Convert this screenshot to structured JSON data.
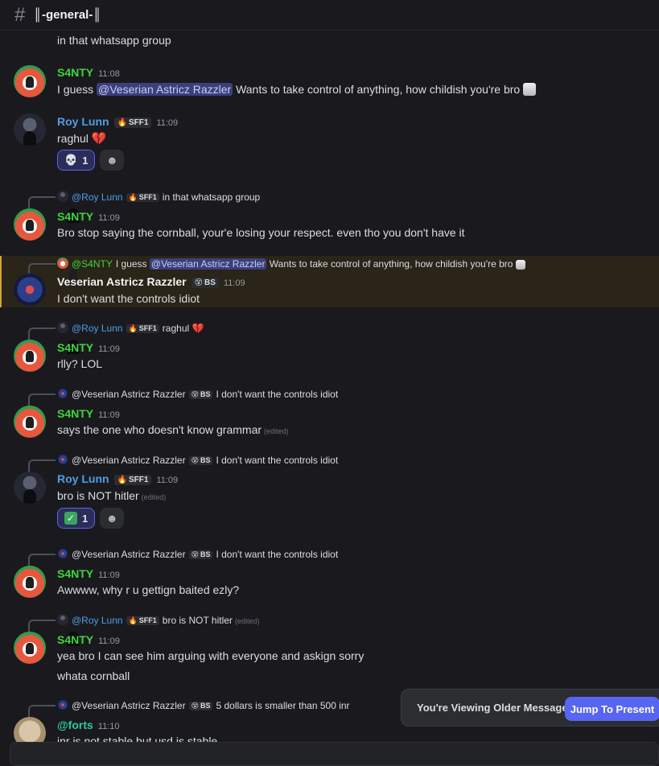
{
  "channel": {
    "name": "║-general-║"
  },
  "top_line": "in that whatsapp group",
  "messages": {
    "m1": {
      "user": "S4NTY",
      "time": "11:08",
      "pre": "I guess ",
      "mention": "@Veserian Astricz Razzler",
      "post": " Wants to take control of anything, how childish you're bro"
    },
    "m2": {
      "user": "Roy Lunn",
      "tag": "SFF1",
      "time": "11:09",
      "text": "raghul",
      "reaction_count": "1"
    },
    "m3": {
      "reply_user": "@Roy Lunn",
      "reply_tag": "SFF1",
      "reply_text": "in that whatsapp group",
      "user": "S4NTY",
      "time": "11:09",
      "text": "Bro stop saying the cornball, your'e losing your respect. even tho you don't have it"
    },
    "m4": {
      "reply_user": "@S4NTY",
      "reply_pre": "I guess ",
      "reply_mention": "@Veserian Astricz Razzler",
      "reply_post": " Wants to take control of anything, how childish you're bro",
      "user": "Veserian Astricz Razzler",
      "tag": "BS",
      "time": "11:09",
      "text": "I don't want the controls idiot"
    },
    "m5": {
      "reply_user": "@Roy Lunn",
      "reply_tag": "SFF1",
      "reply_text": "raghul",
      "user": "S4NTY",
      "time": "11:09",
      "text": "rlly? LOL"
    },
    "m6": {
      "reply_user": "@Veserian Astricz Razzler",
      "reply_tag": "BS",
      "reply_text": "I don't want the controls idiot",
      "user": "S4NTY",
      "time": "11:09",
      "text": "says the one who doesn't know grammar",
      "edited": "(edited)"
    },
    "m7": {
      "reply_user": "@Veserian Astricz Razzler",
      "reply_tag": "BS",
      "reply_text": "I don't want the controls idiot",
      "user": "Roy Lunn",
      "tag": "SFF1",
      "time": "11:09",
      "text": "bro is NOT hitler",
      "edited": "(edited)",
      "reaction_count": "1"
    },
    "m8": {
      "reply_user": "@Veserian Astricz Razzler",
      "reply_tag": "BS",
      "reply_text": "I don't want the controls idiot",
      "user": "S4NTY",
      "time": "11:09",
      "text": "Awwww, why r u gettign baited ezly?"
    },
    "m9": {
      "reply_user": "@Roy Lunn",
      "reply_tag": "SFF1",
      "reply_text": "bro is NOT hitler",
      "reply_edited": "(edited)",
      "user": "S4NTY",
      "time": "11:09",
      "text1": "yea bro I can see him arguing with everyone and askign sorry",
      "text2": "whata  cornball"
    },
    "m10": {
      "reply_user": "@Veserian Astricz Razzler",
      "reply_tag": "BS",
      "reply_text": "5 dollars is smaller than 500 inr",
      "user": "@forts",
      "time": "11:10",
      "text": "inr is not stable but usd is stable"
    }
  },
  "jump": {
    "label": "You're Viewing Older Messages",
    "button": "Jump To Present"
  },
  "colors": {
    "s4nty": "#3ed63e",
    "roy": "#4f9ee8",
    "ves": "#f2f3f5",
    "forts": "#2fc7a0",
    "accent": "#5865f2"
  },
  "icons": [
    "hash-icon",
    "skull-emoji",
    "broken-heart-emoji",
    "check-emoji",
    "add-reaction-icon",
    "fire-icon",
    "face-icon"
  ]
}
